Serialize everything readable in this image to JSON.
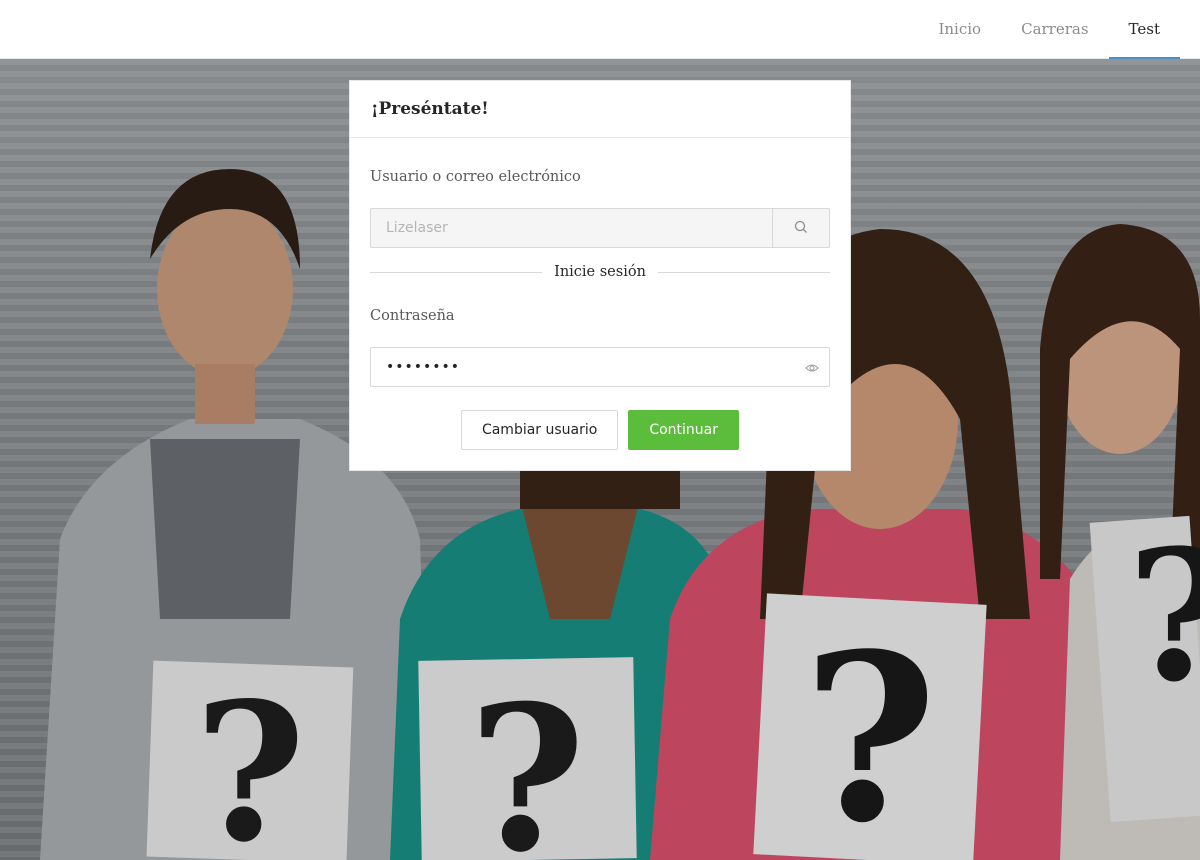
{
  "nav": {
    "items": [
      {
        "label": "Inicio",
        "active": false
      },
      {
        "label": "Carreras",
        "active": false
      },
      {
        "label": "Test",
        "active": true
      }
    ],
    "active_underline_color": "#4a90c8"
  },
  "login_card": {
    "title": "¡Preséntate!",
    "username_label": "Usuario o correo electrónico",
    "username_value": "Lizelaser",
    "search_icon": "search-icon",
    "divider_text": "Inicie sesión",
    "password_label": "Contraseña",
    "password_value": "••••••••",
    "eye_icon": "eye-icon",
    "change_user_label": "Cambiar usuario",
    "continue_label": "Continuar",
    "primary_color": "#5cbd3c"
  },
  "background": {
    "description_icon": "background-photo"
  }
}
